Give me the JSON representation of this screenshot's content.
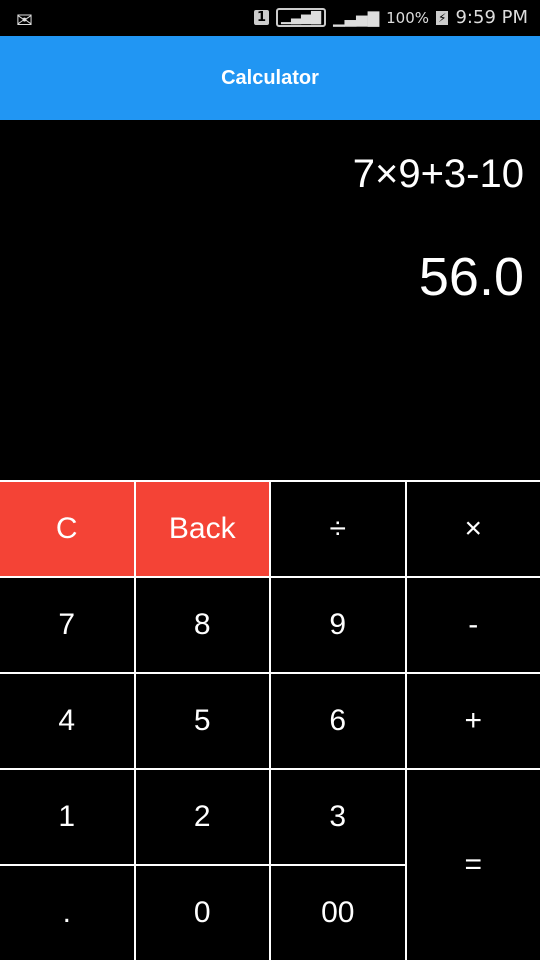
{
  "status": {
    "mail_icon": "envelope-icon",
    "sim": "1",
    "signal1": "▁▃▅▇",
    "signal2": "▁▃▅▇",
    "battery": "100%",
    "battery_icon": "⚡",
    "time": "9:59 PM"
  },
  "appbar": {
    "title": "Calculator"
  },
  "display": {
    "expression": "7×9+3-10",
    "result": "56.0"
  },
  "keys": {
    "clear": "C",
    "back": "Back",
    "divide": "÷",
    "multiply": "×",
    "k7": "7",
    "k8": "8",
    "k9": "9",
    "minus": "-",
    "k4": "4",
    "k5": "5",
    "k6": "6",
    "plus": "+",
    "k1": "1",
    "k2": "2",
    "k3": "3",
    "equals": "=",
    "dot": ".",
    "k0": "0",
    "k00": "00"
  },
  "colors": {
    "appbar": "#2196F3",
    "clear_keys": "#F44336"
  }
}
